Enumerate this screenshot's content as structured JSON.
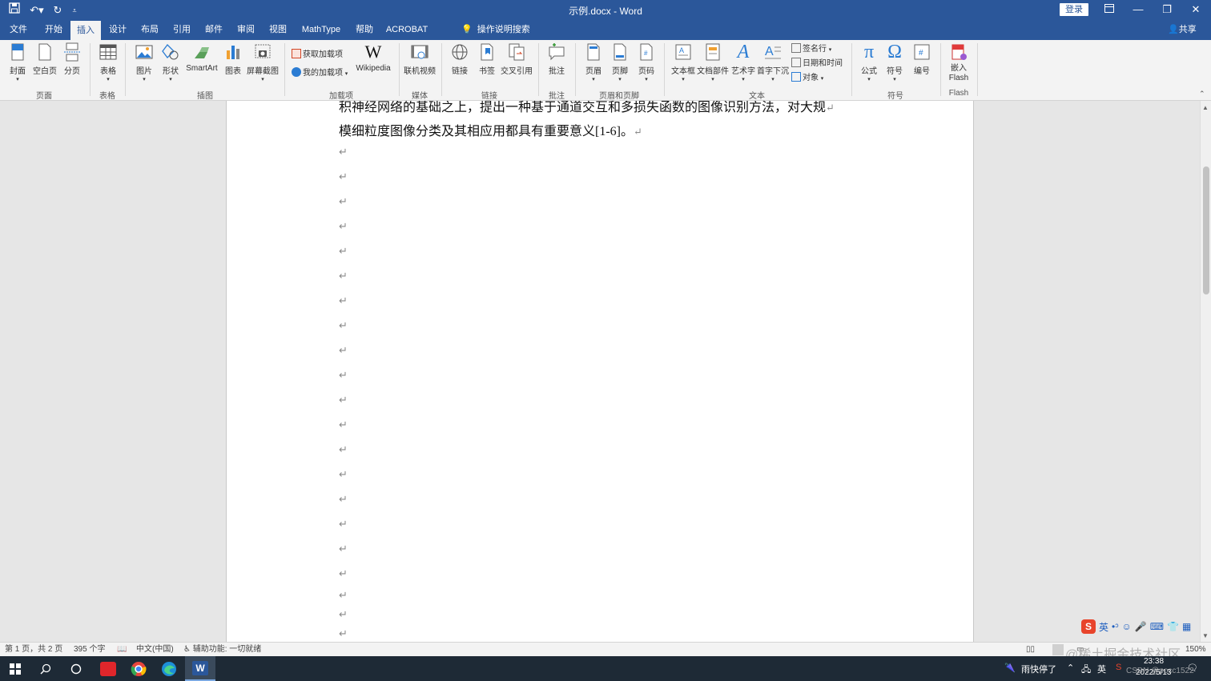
{
  "window": {
    "title": "示例.docx  -  Word",
    "login_label": "登录",
    "share_label": "共享"
  },
  "tabs": [
    {
      "label": "文件"
    },
    {
      "label": "开始"
    },
    {
      "label": "插入"
    },
    {
      "label": "设计"
    },
    {
      "label": "布局"
    },
    {
      "label": "引用"
    },
    {
      "label": "邮件"
    },
    {
      "label": "审阅"
    },
    {
      "label": "视图"
    },
    {
      "label": "MathType"
    },
    {
      "label": "帮助"
    },
    {
      "label": "ACROBAT"
    }
  ],
  "active_tab": "插入",
  "tell_me": "操作说明搜索",
  "ribbon": {
    "page": {
      "label": "页面",
      "cover": "封面",
      "blank": "空白页",
      "break": "分页"
    },
    "table": {
      "label": "表格",
      "table": "表格"
    },
    "illustrations": {
      "label": "插图",
      "pictures": "图片",
      "shapes": "形状",
      "smartart": "SmartArt",
      "chart": "图表",
      "screenshot": "屏幕截图"
    },
    "addins": {
      "label": "加载项",
      "get": "获取加载项",
      "my": "我的加载项",
      "wikipedia": "Wikipedia"
    },
    "media": {
      "label": "媒体",
      "online_video": "联机视频"
    },
    "links": {
      "label": "链接",
      "link": "链接",
      "bookmark": "书签",
      "crossref": "交叉引用"
    },
    "comments": {
      "label": "批注",
      "comment": "批注"
    },
    "header_footer": {
      "label": "页眉和页脚",
      "header": "页眉",
      "footer": "页脚",
      "page_number": "页码"
    },
    "text": {
      "label": "文本",
      "textbox": "文本框",
      "quick_parts": "文档部件",
      "wordart": "艺术字",
      "dropcap": "首字下沉",
      "signature": "签名行",
      "datetime": "日期和时间",
      "object": "对象"
    },
    "symbols": {
      "label": "符号",
      "equation": "公式",
      "symbol": "符号",
      "number": "编号"
    },
    "flash": {
      "label": "Flash",
      "embed": "嵌入\nFlash"
    }
  },
  "document": {
    "line1": "积神经网络的基础之上，提出一种基于通道交互和多损失函数的图像识别方法，对大规",
    "line2": "模细粒度图像分类及其相应用都具有重要意义[1-6]。",
    "para_mark": "↵"
  },
  "status": {
    "page": "第 1 页，共 2 页",
    "words": "395 个字",
    "lang": "中文(中国)",
    "accessibility": "辅助功能: 一切就绪",
    "zoom": "150%"
  },
  "ime": {
    "lang": "英"
  },
  "taskbar": {
    "weather": "雨快停了",
    "ime_lang": "英",
    "time": "23:38",
    "date": "2022/5/13"
  },
  "watermark": "@稀土掘金技术社区",
  "watermark2": "CSDN @pocc1522"
}
